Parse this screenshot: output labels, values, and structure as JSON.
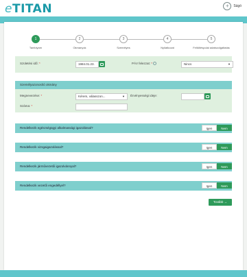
{
  "header": {
    "logo_prefix": "e",
    "logo_main": "TITAN",
    "help_label": "Súgó",
    "help_icon_glyph": "+"
  },
  "steps": [
    {
      "number": "1",
      "label": "Tanfolyam",
      "active": true
    },
    {
      "number": "2",
      "label": "Okmányok",
      "active": false
    },
    {
      "number": "3",
      "label": "Személyes",
      "active": false
    },
    {
      "number": "4",
      "label": "Nyilatkozat",
      "active": false
    },
    {
      "number": "5",
      "label": "Feltöltéspolai adatszolgáltatás",
      "active": false
    }
  ],
  "birth": {
    "label": "Születési idő:",
    "value": "1984.01.23.",
    "pav_label": "PÁV felezzat:",
    "pav_value": "Nincs"
  },
  "id_doc": {
    "heading": "Személyazonosító okmány",
    "type_label": "Megnevezése:",
    "type_value": "Kérem, válasszon...",
    "validity_label": "Érvényességi ideje:",
    "number_label": "Száma:",
    "number_value": ""
  },
  "questions": [
    {
      "text": "Rendelkezik egészségügyi alkalmassági igazolással?",
      "yes": "Igen",
      "no": "Nem",
      "selected": "no"
    },
    {
      "text": "Rendelkezik vizsgaigazolással?",
      "yes": "Igen",
      "no": "Nem",
      "selected": "no"
    },
    {
      "text": "Rendelkezik járművezetői igazolvánnyal?",
      "yes": "Igen",
      "no": "Nem",
      "selected": "no"
    },
    {
      "text": "Rendelkezik vezetői engedéllyel?",
      "yes": "Igen",
      "no": "Nem",
      "selected": "no"
    }
  ],
  "actions": {
    "next_label": "Tovább",
    "next_arrow": "→"
  },
  "colors": {
    "accent_green": "#2e9a5a",
    "teal": "#7fcfcd",
    "panel_bg": "#dff0df",
    "logo": "#1b9aa8"
  }
}
